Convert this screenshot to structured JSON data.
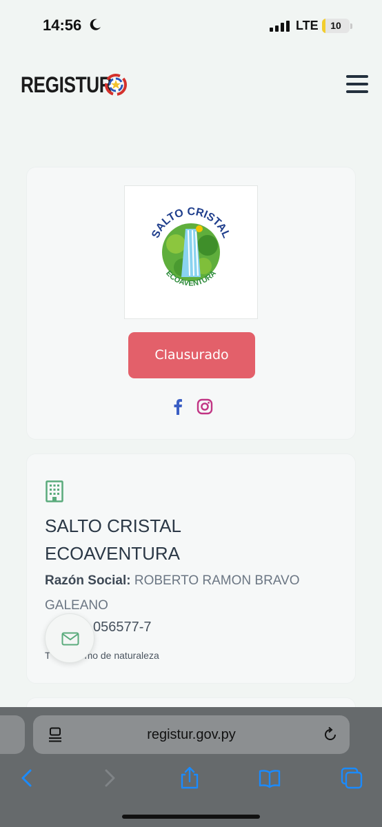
{
  "status_bar": {
    "time": "14:56",
    "network": "LTE",
    "battery_level": "10",
    "battery_fraction": 0.1
  },
  "header": {
    "logo_text": "REGISTUR",
    "menu_icon": "hamburger-menu-icon"
  },
  "listing": {
    "logo_alt_lines": [
      "SALTO CRISTAL",
      "ECOAVENTURA"
    ],
    "status_label": "Clausurado",
    "status_color": "#e3606a",
    "social": [
      "facebook-icon",
      "instagram-icon"
    ],
    "business_name": "SALTO CRISTAL ECOAVENTURA",
    "legal_label": "Razón Social:",
    "legal_value": "ROBERTO RAMON BRAVO GALEANO",
    "ruc_visible": "056577-7",
    "type_visible_start": "T",
    "type_visible_end": "smo de naturaleza"
  },
  "browser": {
    "url": "registur.gov.py"
  },
  "colors": {
    "background": "#f1f5f3",
    "accent_green": "#5aab7c",
    "safari_bar": "#666a6c",
    "safari_icons": "#1a8bff"
  }
}
